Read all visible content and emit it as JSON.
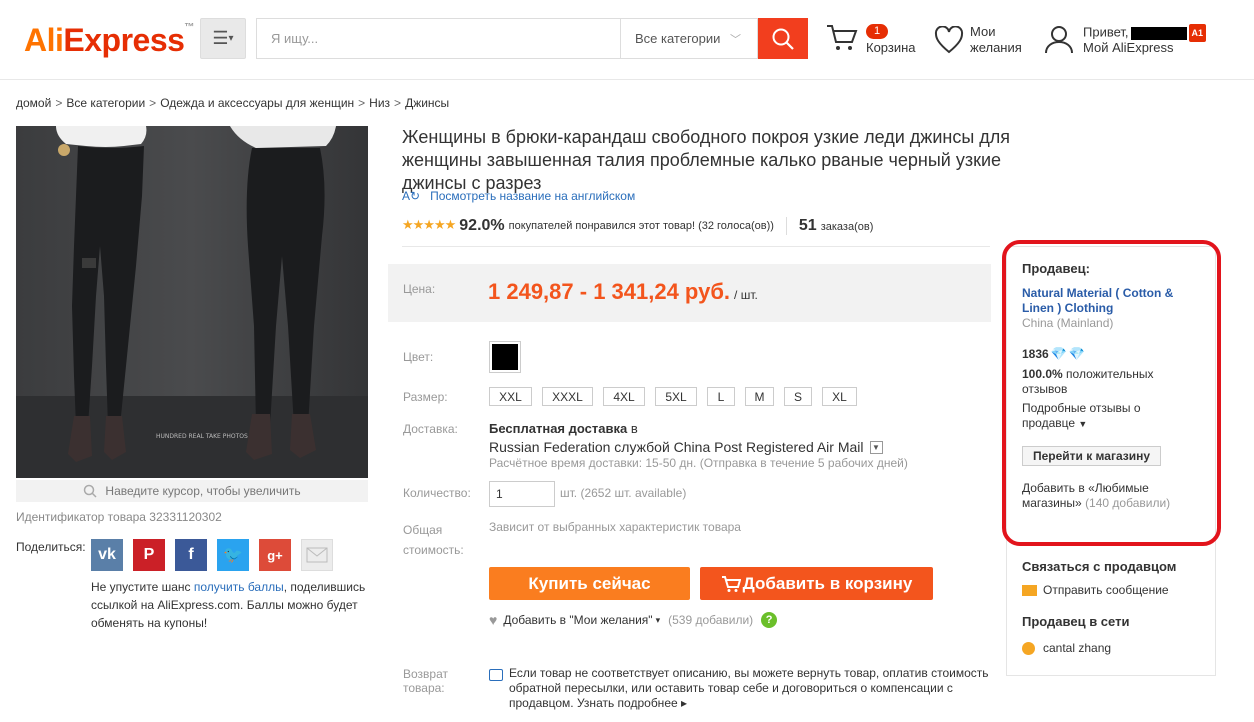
{
  "header": {
    "logo": "AliExpress",
    "search_placeholder": "Я ищу...",
    "category": "Все категории",
    "cart_count": "1",
    "cart_label": "Корзина",
    "wishlist_line1": "Мои",
    "wishlist_line2": "желания",
    "greeting": "Привет,",
    "user_badge": "A1",
    "my_account": "Мой AliExpress"
  },
  "breadcrumb": [
    "домой",
    "Все категории",
    "Одежда и аксессуары для женщин",
    "Низ",
    "Джинсы"
  ],
  "gallery": {
    "zoom_hint": "Наведите курсор, чтобы увеличить",
    "watermark": "HUNDRED REAL TAKE PHOTOS",
    "product_id": "Идентификатор товара 32331120302"
  },
  "share": {
    "label": "Поделиться:",
    "promo_pre": "Не упустите шанс ",
    "promo_link": "получить баллы",
    "promo_post": ", поделившись ссылкой на AliExpress.com. Баллы можно будет обменять на купоны!"
  },
  "product": {
    "title": "Женщины в брюки-карандаш свободного покроя узкие леди джинсы для женщины завышенная талия проблемные калько рваные черный узкие джинсы с разрез",
    "translate_link": "Посмотреть название на английском",
    "rating_percent": "92.0%",
    "rating_text": "покупателей понравился этот товар! (32 голоса(ов))",
    "orders_count": "51",
    "orders_label": "заказа(ов)",
    "rating_stars": 4.6
  },
  "price": {
    "label": "Цена:",
    "value": "1 249,87 - 1 341,24 руб.",
    "unit": "/ шт."
  },
  "options": {
    "color_label": "Цвет:",
    "size_label": "Размер:",
    "sizes": [
      "XXL",
      "XXXL",
      "4XL",
      "5XL",
      "L",
      "M",
      "S",
      "XL"
    ]
  },
  "shipping": {
    "label": "Доставка:",
    "title": "Бесплатная доставка",
    "title_suffix": "в",
    "line": "Russian Federation службой China Post Registered Air Mail",
    "estimate": "Расчётное время доставки: 15-50 дн. (Отправка в течение 5 рабочих дней)"
  },
  "quantity": {
    "label": "Количество:",
    "value": "1",
    "note": "шт. (2652 шт. available)"
  },
  "total": {
    "label_line1": "Общая",
    "label_line2": "стоимость:",
    "note": "Зависит от выбранных характеристик товара"
  },
  "actions": {
    "buy": "Купить сейчас",
    "add_to_cart": "Добавить в корзину",
    "wishlist": "Добавить в \"Мои желания\"",
    "wishlist_count": "(539 добавили)"
  },
  "returns": {
    "label_line1": "Возврат",
    "label_line2": "товара:",
    "text": "Если товар не соответствует описанию, вы можете вернуть товар, оплатив стоимость обратной пересылки, или оставить товар себе и договориться о компенсации с продавцом.",
    "more": "Узнать подробнее"
  },
  "seller": {
    "heading": "Продавец:",
    "name": "Natural Material ( Cotton & Linen ) Clothing",
    "location": "China (Mainland)",
    "score": "1836",
    "feedback_pct": "100.0%",
    "feedback_text": "положительных отзывов",
    "detailed": "Подробные отзывы о продавце",
    "store_button": "Перейти к магазину",
    "fav_text": "Добавить в «Любимые магазины»",
    "fav_count": "(140 добавили)",
    "contact_heading": "Связаться с продавцом",
    "message": "Отправить сообщение",
    "online_heading": "Продавец в сети",
    "online_name": "cantal zhang"
  },
  "colors": {
    "brand_orange": "#ff7300",
    "brand_red": "#e62e04",
    "price": "#f3551d",
    "buy_button": "#fa7d1f",
    "highlight": "#e2141c",
    "link": "#2a6ebb"
  }
}
